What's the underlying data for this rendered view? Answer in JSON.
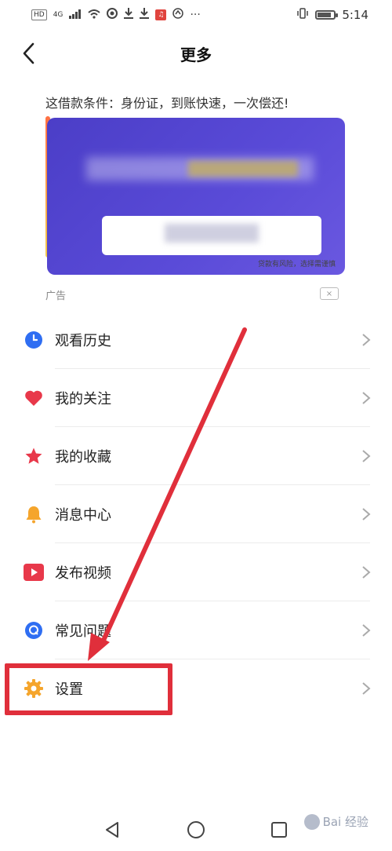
{
  "status_bar": {
    "left_labels": [
      "HD",
      "4G"
    ],
    "time": "5:14",
    "battery_level": 0.85
  },
  "header": {
    "title": "更多"
  },
  "ad": {
    "title": "这借款条件：身份证，到账快速，一次偿还!",
    "small_note": "贷款有风险，选择需谨慎",
    "label": "广告",
    "close_glyph": "×"
  },
  "menu": {
    "items": [
      {
        "label": "观看历史",
        "icon": "clock-icon",
        "color": "#2f6ef2"
      },
      {
        "label": "我的关注",
        "icon": "heart-icon",
        "color": "#e8384a"
      },
      {
        "label": "我的收藏",
        "icon": "star-icon",
        "color": "#e8384a"
      },
      {
        "label": "消息中心",
        "icon": "bell-icon",
        "color": "#f5a52c"
      },
      {
        "label": "发布视频",
        "icon": "play-icon",
        "color": "#e8384a"
      },
      {
        "label": "常见问题",
        "icon": "question-icon",
        "color": "#2f6ef2"
      },
      {
        "label": "设置",
        "icon": "gear-icon",
        "color": "#f5a52c"
      }
    ]
  },
  "annotation": {
    "color": "#e02f3b"
  },
  "watermark": {
    "text": "Bai 经验"
  }
}
